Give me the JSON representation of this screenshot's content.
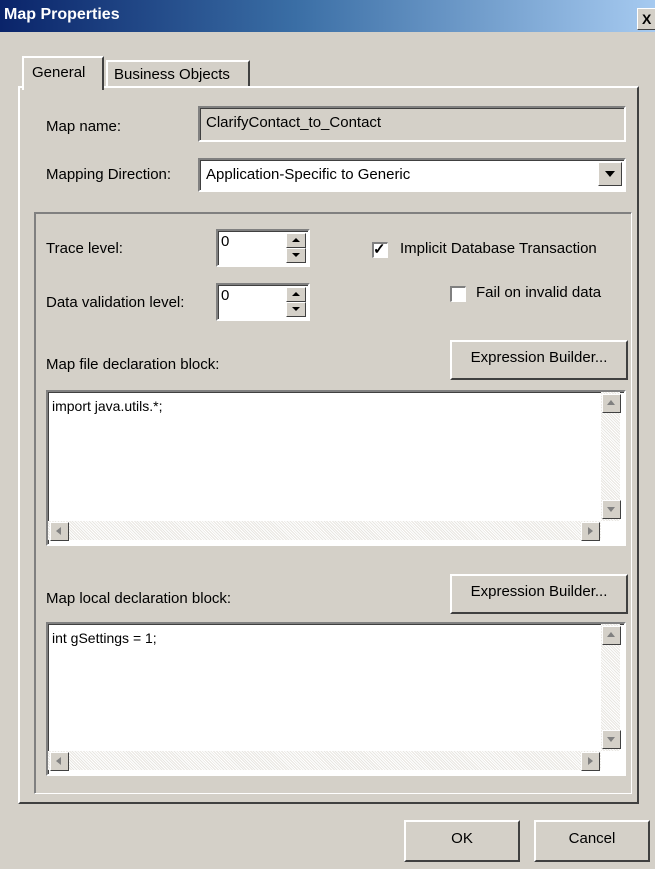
{
  "window": {
    "title": "Map Properties",
    "close_glyph": "X"
  },
  "tabs": [
    {
      "label": "General",
      "selected": true
    },
    {
      "label": "Business Objects",
      "selected": false
    }
  ],
  "map_name": {
    "label": "Map name:",
    "value": "ClarifyContact_to_Contact"
  },
  "mapping_direction": {
    "label": "Mapping Direction:",
    "value": "Application-Specific to Generic"
  },
  "trace_level": {
    "label": "Trace level:",
    "value": "0"
  },
  "data_validation_level": {
    "label": "Data validation level:",
    "value": "0"
  },
  "implicit_db_transaction": {
    "label": "Implicit Database Transaction",
    "checked": true
  },
  "fail_on_invalid_data": {
    "label": "Fail on invalid data",
    "checked": false
  },
  "map_file_decl": {
    "label": "Map file declaration block:",
    "button": "Expression Builder...",
    "code": "import java.utils.*;"
  },
  "map_local_decl": {
    "label": "Map local declaration block:",
    "button": "Expression Builder...",
    "code": "int gSettings = 1;"
  },
  "buttons": {
    "ok": "OK",
    "cancel": "Cancel"
  },
  "icons": {
    "checked_glyph": "✓"
  },
  "colors": {
    "titlebar_start": "#0a246a",
    "dialog_face": "#d4d0c8"
  }
}
